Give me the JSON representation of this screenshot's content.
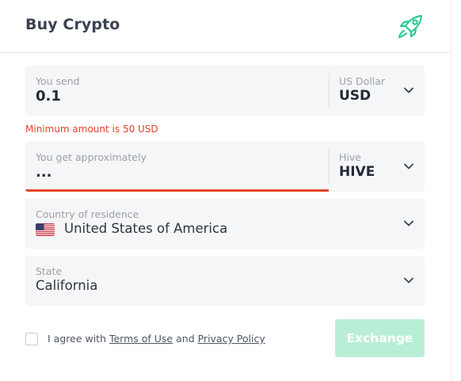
{
  "header": {
    "title": "Buy Crypto",
    "icon": "rocket-icon",
    "accent_color": "#2ecc8f"
  },
  "send_field": {
    "label": "You send",
    "value": "0.1",
    "currency_label": "US Dollar",
    "currency_code": "USD"
  },
  "error_message": {
    "text": "Minimum amount is 50 USD",
    "color": "#e2402b"
  },
  "get_field": {
    "label": "You get approximately",
    "value": "...",
    "currency_label": "Hive",
    "currency_code": "HIVE"
  },
  "country_field": {
    "label": "Country of residence",
    "value": "United States of America",
    "flag_icon": "us-flag-icon"
  },
  "state_field": {
    "label": "State",
    "value": "California"
  },
  "agreement": {
    "prefix": "I agree with ",
    "terms_link": "Terms of Use",
    "middle": " and ",
    "privacy_link": "Privacy Policy",
    "checked": false
  },
  "exchange_button": {
    "label": "Exchange",
    "color": "#b9eed6",
    "disabled": true
  }
}
